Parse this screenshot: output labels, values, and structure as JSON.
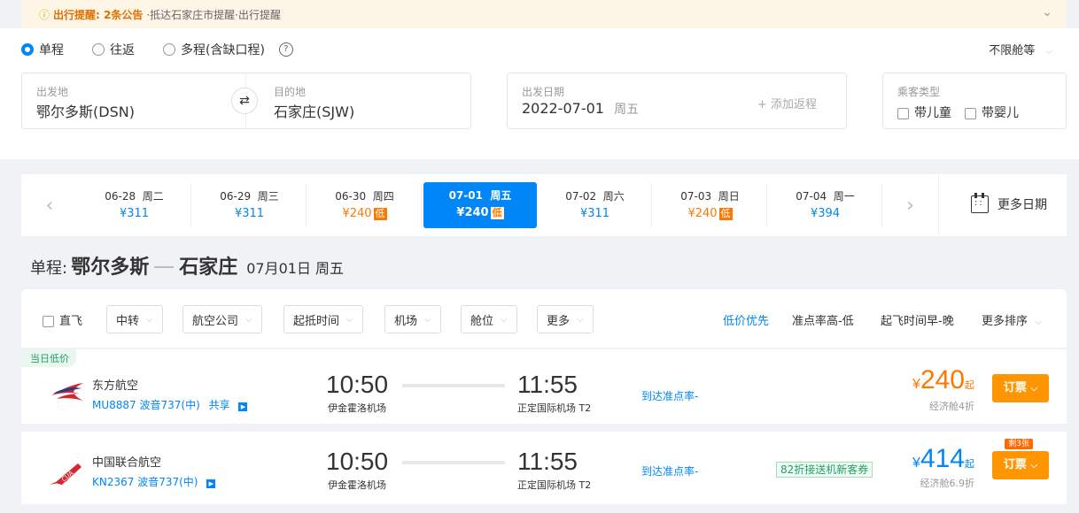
{
  "notice": {
    "title": "出行提醒: 2条公告",
    "text": "·抵达石家庄市提醒·出行提醒"
  },
  "trip_types": [
    {
      "label": "单程",
      "selected": true
    },
    {
      "label": "往返",
      "selected": false
    },
    {
      "label": "多程(含缺口程)",
      "selected": false
    }
  ],
  "cabin_class": "不限舱等",
  "search": {
    "from_label": "出发地",
    "from_value": "鄂尔多斯(DSN)",
    "to_label": "目的地",
    "to_value": "石家庄(SJW)",
    "date_label": "出发日期",
    "date_value": "2022-07-01",
    "date_weekday": "周五",
    "add_return": "+ 添加返程",
    "passenger_label": "乘客类型",
    "child": "带儿童",
    "infant": "带婴儿"
  },
  "date_strip": [
    {
      "date": "06-28",
      "weekday": "周二",
      "price": "¥311",
      "low": false,
      "selected": false
    },
    {
      "date": "06-29",
      "weekday": "周三",
      "price": "¥311",
      "low": false,
      "selected": false
    },
    {
      "date": "06-30",
      "weekday": "周四",
      "price": "¥240",
      "low": true,
      "selected": false
    },
    {
      "date": "07-01",
      "weekday": "周五",
      "price": "¥240",
      "low": true,
      "selected": true
    },
    {
      "date": "07-02",
      "weekday": "周六",
      "price": "¥311",
      "low": false,
      "selected": false
    },
    {
      "date": "07-03",
      "weekday": "周日",
      "price": "¥240",
      "low": true,
      "selected": false
    },
    {
      "date": "07-04",
      "weekday": "周一",
      "price": "¥394",
      "low": false,
      "selected": false
    }
  ],
  "low_tag": "低",
  "more_dates": "更多日期",
  "route": {
    "prefix": "单程:",
    "from": "鄂尔多斯",
    "to": "石家庄",
    "date": "07月01日 周五"
  },
  "filters": {
    "direct": "直飞",
    "buttons": [
      "中转",
      "航空公司",
      "起抵时间",
      "机场",
      "舱位",
      "更多"
    ],
    "sorts": [
      "低价优先",
      "准点率高-低",
      "起飞时间早-晚",
      "更多排序"
    ]
  },
  "flights": [
    {
      "badge": "当日低价",
      "airline": "东方航空",
      "flight_no": "MU8887 波音737(中)",
      "share": "共享",
      "dep_time": "10:50",
      "dep_airport": "伊金霍洛机场",
      "arr_time": "11:55",
      "arr_airport": "正定国际机场 T2",
      "ontime": "到达准点率-",
      "promo": "",
      "currency": "¥",
      "price": "240",
      "price_suffix": "起",
      "cabin": "经济舱4折",
      "book": "订票",
      "remain": "",
      "price_color": "#ff7700"
    },
    {
      "badge": "",
      "airline": "中国联合航空",
      "flight_no": "KN2367 波音737(中)",
      "share": "",
      "dep_time": "10:50",
      "dep_airport": "伊金霍洛机场",
      "arr_time": "11:55",
      "arr_airport": "正定国际机场 T2",
      "ontime": "到达准点率-",
      "promo": "82折接送机新客券",
      "currency": "¥",
      "price": "414",
      "price_suffix": "起",
      "cabin": "经济舱6.9折",
      "book": "订票",
      "remain": "剩3张",
      "price_color": "#0086f6"
    }
  ]
}
